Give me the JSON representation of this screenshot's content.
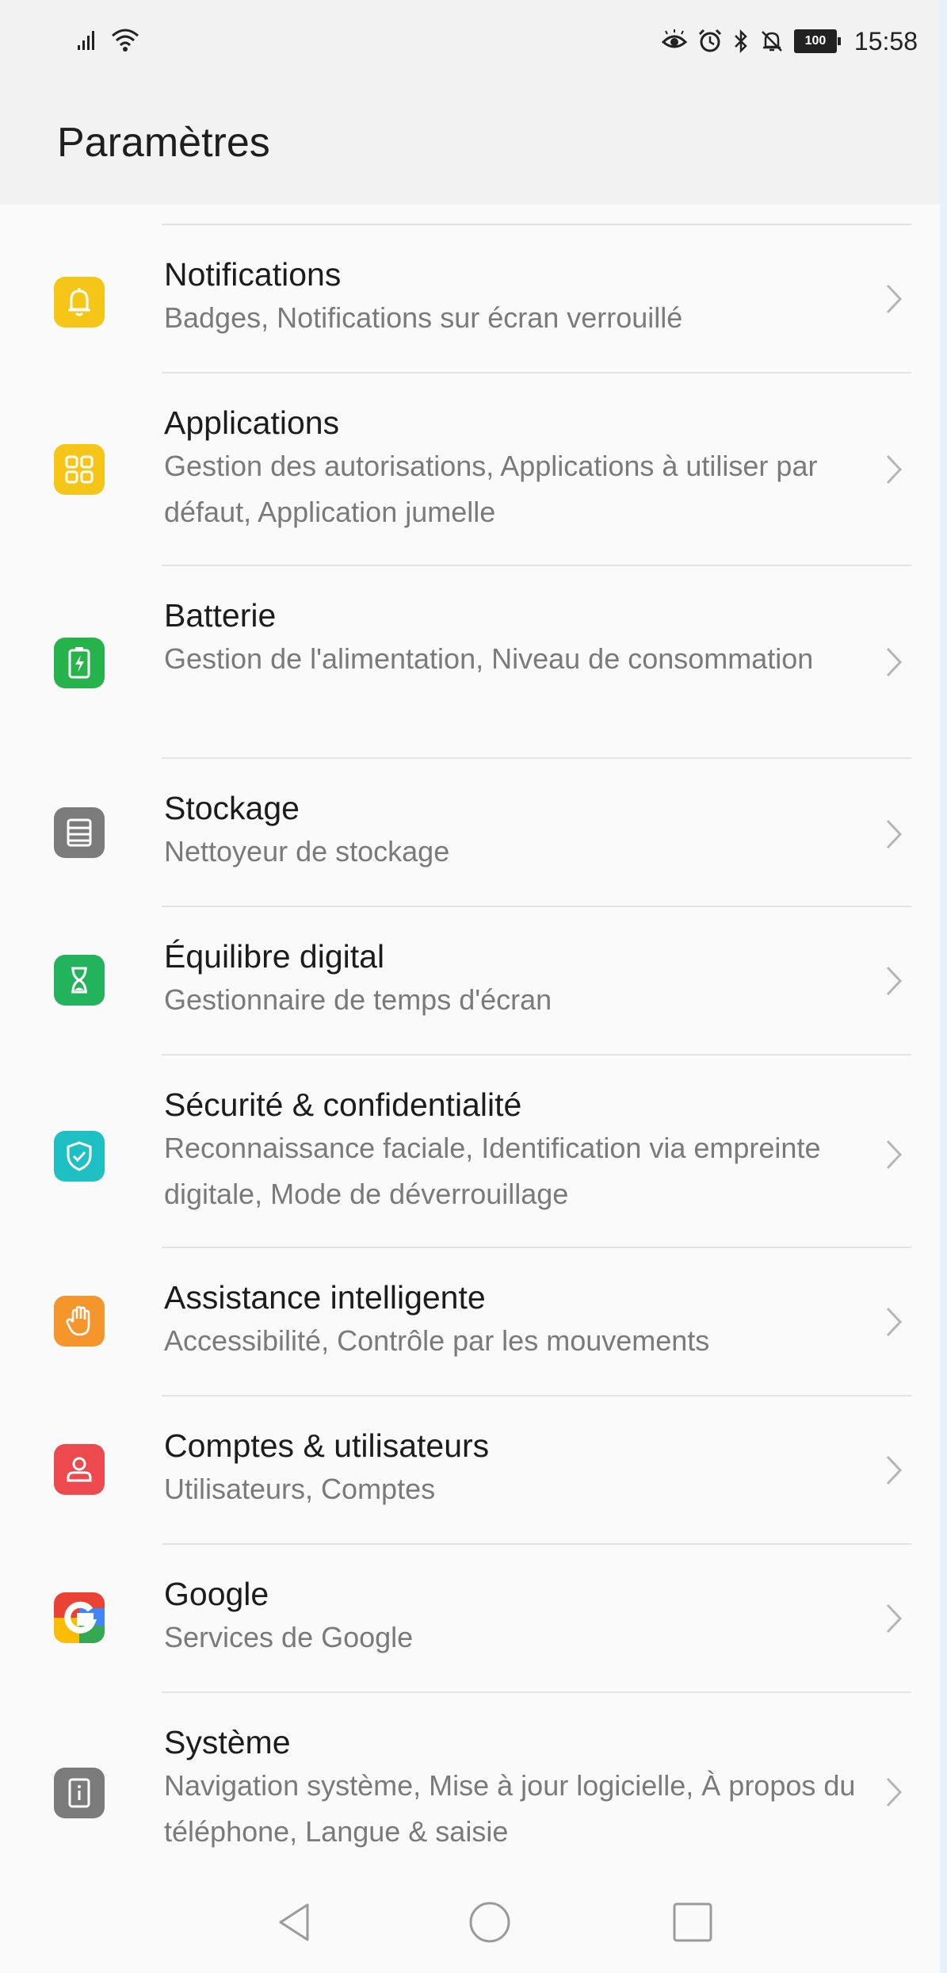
{
  "status_bar": {
    "time": "15:58",
    "battery": "100",
    "icons": [
      "signal-icon",
      "wifi-icon",
      "eye-comfort-icon",
      "alarm-icon",
      "bluetooth-icon",
      "silent-icon",
      "battery-icon"
    ]
  },
  "header": {
    "title": "Paramètres"
  },
  "items": [
    {
      "title": "Notifications",
      "subtitle": "Badges, Notifications sur écran verrouillé",
      "icon": "bell-icon",
      "color": "#f5c518"
    },
    {
      "title": "Applications",
      "subtitle": "Gestion des autorisations, Applications à utiliser par défaut, Application jumelle",
      "icon": "apps-grid-icon",
      "color": "#f5c518"
    },
    {
      "title": "Batterie",
      "subtitle": "Gestion de l'alimentation, Niveau de consommation",
      "icon": "battery-charging-icon",
      "color": "#27b34b"
    },
    {
      "title": "Stockage",
      "subtitle": "Nettoyeur de stockage",
      "icon": "storage-icon",
      "color": "#7b7b7b"
    },
    {
      "title": "Équilibre digital",
      "subtitle": "Gestionnaire de temps d'écran",
      "icon": "hourglass-icon",
      "color": "#22b35c"
    },
    {
      "title": "Sécurité & confidentialité",
      "subtitle": "Reconnaissance faciale, Identification via empreinte digitale, Mode de déverrouillage",
      "icon": "shield-check-icon",
      "color": "#1fc0c4"
    },
    {
      "title": "Assistance intelligente",
      "subtitle": "Accessibilité, Contrôle par les mouvements",
      "icon": "hand-icon",
      "color": "#f5962c"
    },
    {
      "title": "Comptes & utilisateurs",
      "subtitle": "Utilisateurs, Comptes",
      "icon": "user-icon",
      "color": "#ec4a4e"
    },
    {
      "title": "Google",
      "subtitle": "Services de Google",
      "icon": "google-icon",
      "color": "#4285f4"
    },
    {
      "title": "Système",
      "subtitle": "Navigation système, Mise à jour logicielle, À propos du téléphone, Langue & saisie",
      "icon": "phone-info-icon",
      "color": "#7b7b7b"
    }
  ],
  "navbar": {
    "icons": [
      "back-icon",
      "home-icon",
      "recents-icon"
    ]
  }
}
